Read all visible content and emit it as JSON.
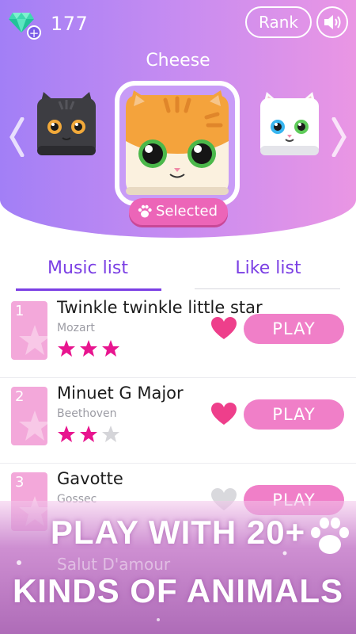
{
  "colors": {
    "accent_purple": "#7b3fe4",
    "pink": "#f07fc8",
    "star_on": "#e8158f",
    "star_off": "#d5d5d9",
    "heart_on": "#ee3f8b",
    "heart_off": "#d9d9dd"
  },
  "header": {
    "gem_count": "177",
    "gem_icon": "diamond-icon",
    "rank_label": "Rank",
    "sound_icon": "speaker-icon",
    "character_name": "Cheese",
    "selected_label": "Selected"
  },
  "tabs": {
    "music_list": "Music list",
    "like_list": "Like list",
    "active": "Music list"
  },
  "songs": [
    {
      "number": "1",
      "title": "Twinkle twinkle little star",
      "composer": "Mozart",
      "stars": 3,
      "liked": true,
      "play_label": "PLAY"
    },
    {
      "number": "2",
      "title": "Minuet G Major",
      "composer": "Beethoven",
      "stars": 2,
      "liked": true,
      "play_label": "PLAY"
    },
    {
      "number": "3",
      "title": "Gavotte",
      "composer": "Gossec",
      "stars": 0,
      "liked": false,
      "play_label": "PLAY"
    }
  ],
  "ghost_song": "Salut D'amour",
  "promo": {
    "line1": "PLAY WITH 20+",
    "line2": "KINDS OF ANIMALS"
  }
}
